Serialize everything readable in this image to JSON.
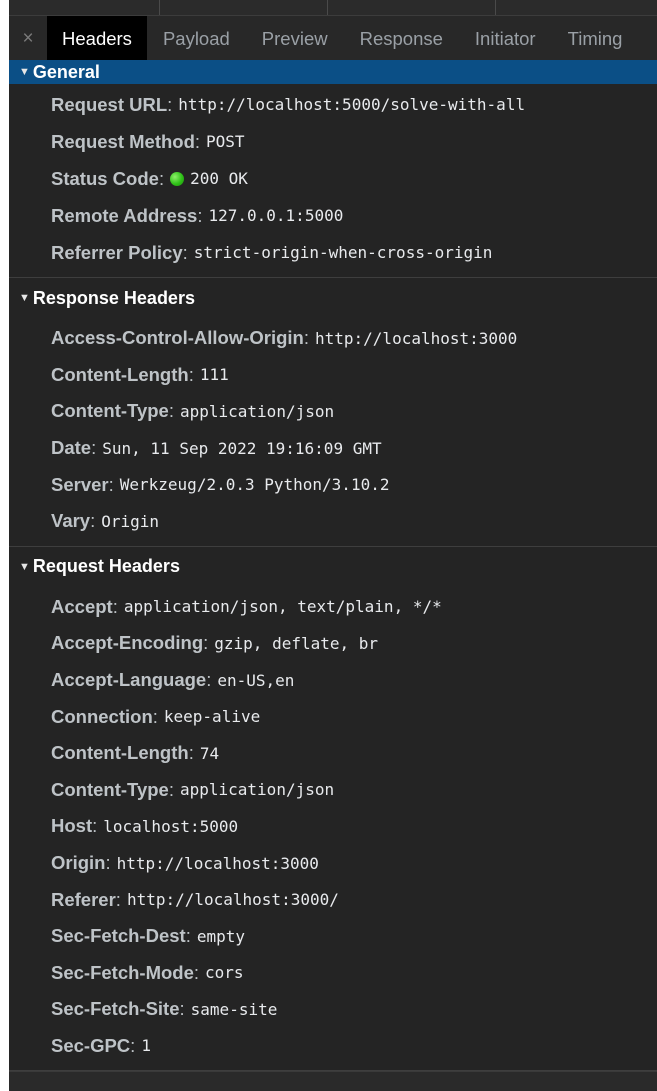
{
  "tabs": {
    "close_glyph": "×",
    "items": [
      {
        "label": "Headers",
        "active": true
      },
      {
        "label": "Payload",
        "active": false
      },
      {
        "label": "Preview",
        "active": false
      },
      {
        "label": "Response",
        "active": false
      },
      {
        "label": "Initiator",
        "active": false
      },
      {
        "label": "Timing",
        "active": false
      }
    ]
  },
  "general": {
    "title": "General",
    "rows": [
      {
        "name": "Request URL",
        "value": "http://localhost:5000/solve-with-all"
      },
      {
        "name": "Request Method",
        "value": "POST"
      },
      {
        "name": "Status Code",
        "value": "200 OK",
        "status_color": "#2fc118"
      },
      {
        "name": "Remote Address",
        "value": "127.0.0.1:5000"
      },
      {
        "name": "Referrer Policy",
        "value": "strict-origin-when-cross-origin"
      }
    ]
  },
  "response_headers": {
    "title": "Response Headers",
    "rows": [
      {
        "name": "Access-Control-Allow-Origin",
        "value": "http://localhost:3000"
      },
      {
        "name": "Content-Length",
        "value": "111"
      },
      {
        "name": "Content-Type",
        "value": "application/json"
      },
      {
        "name": "Date",
        "value": "Sun, 11 Sep 2022 19:16:09 GMT"
      },
      {
        "name": "Server",
        "value": "Werkzeug/2.0.3 Python/3.10.2"
      },
      {
        "name": "Vary",
        "value": "Origin"
      }
    ]
  },
  "request_headers": {
    "title": "Request Headers",
    "rows": [
      {
        "name": "Accept",
        "value": "application/json, text/plain, */*"
      },
      {
        "name": "Accept-Encoding",
        "value": "gzip, deflate, br"
      },
      {
        "name": "Accept-Language",
        "value": "en-US,en"
      },
      {
        "name": "Connection",
        "value": "keep-alive"
      },
      {
        "name": "Content-Length",
        "value": "74"
      },
      {
        "name": "Content-Type",
        "value": "application/json"
      },
      {
        "name": "Host",
        "value": "localhost:5000"
      },
      {
        "name": "Origin",
        "value": "http://localhost:3000"
      },
      {
        "name": "Referer",
        "value": "http://localhost:3000/"
      },
      {
        "name": "Sec-Fetch-Dest",
        "value": "empty"
      },
      {
        "name": "Sec-Fetch-Mode",
        "value": "cors"
      },
      {
        "name": "Sec-Fetch-Site",
        "value": "same-site"
      },
      {
        "name": "Sec-GPC",
        "value": "1"
      }
    ]
  },
  "colors": {
    "panel_bg": "#242424",
    "general_header_bg": "#0b4f86",
    "active_tab_bg": "#000000",
    "status_ok": "#2fc118"
  },
  "icons": {
    "close": "close-icon",
    "expand": "triangle-down-icon",
    "status": "status-dot-icon"
  }
}
